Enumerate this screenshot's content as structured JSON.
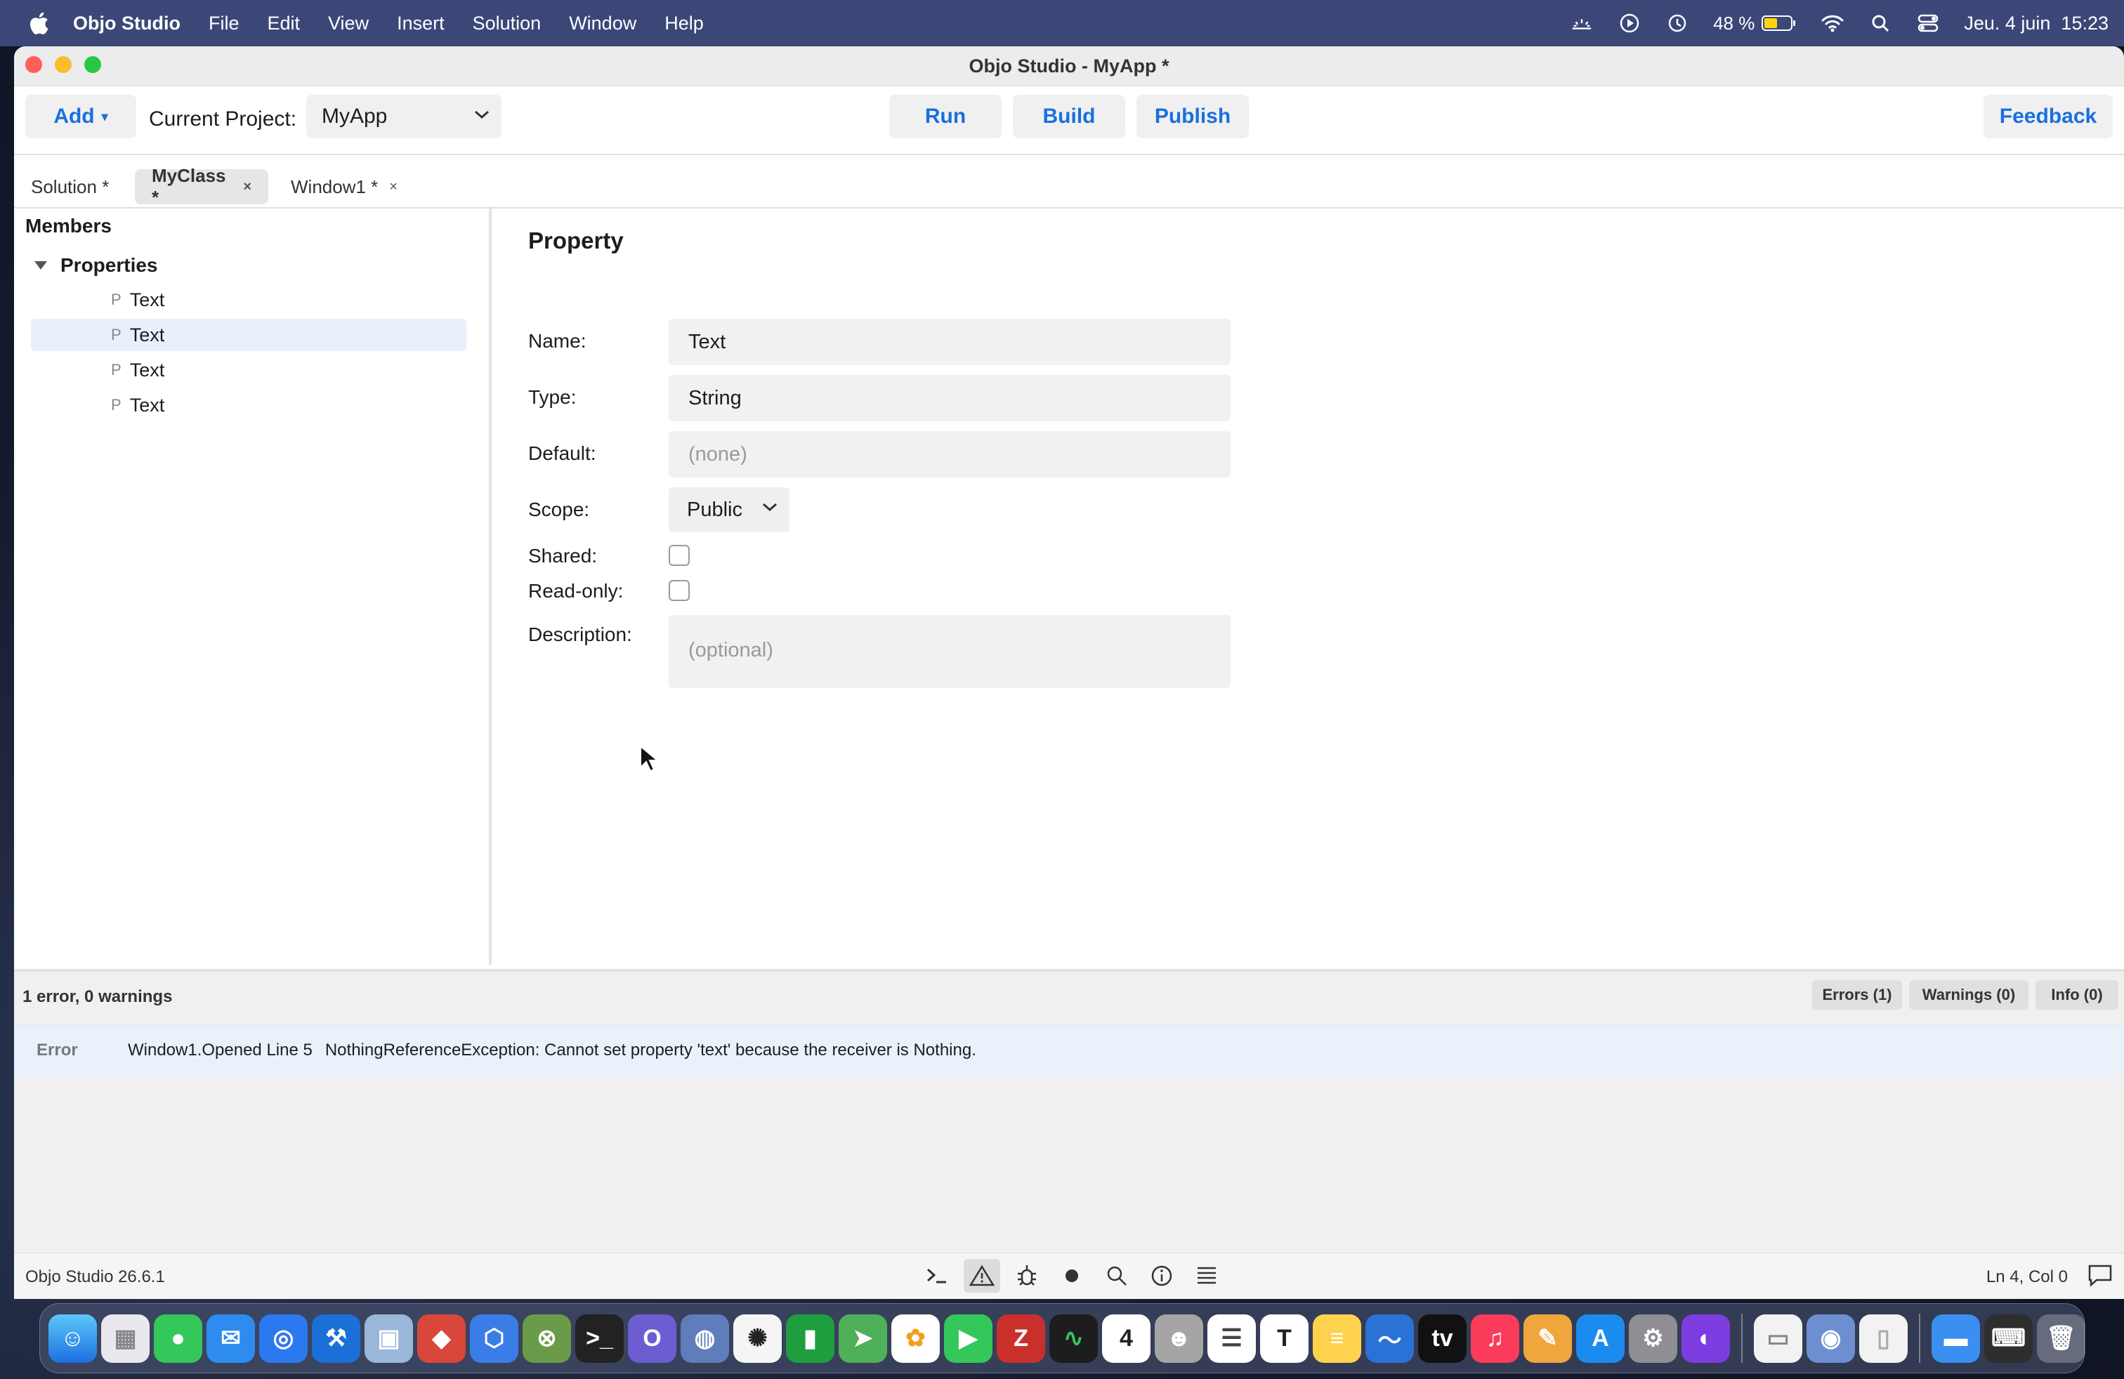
{
  "menubar": {
    "app_name": "Objo Studio",
    "menus": [
      "File",
      "Edit",
      "View",
      "Insert",
      "Solution",
      "Window",
      "Help"
    ],
    "battery": "48 %",
    "datetime": "Jeu. 4 juin  15:23"
  },
  "window": {
    "title": "Objo Studio - MyApp *"
  },
  "toolbar": {
    "add_label": "Add",
    "add_arrow": "▾",
    "project_label": "Current Project:",
    "project_value": "MyApp",
    "run_label": "Run",
    "build_label": "Build",
    "publish_label": "Publish",
    "feedback_label": "Feedback"
  },
  "tabs": [
    {
      "label": "Solution *",
      "close": ""
    },
    {
      "label": "MyClass *",
      "close": "×"
    },
    {
      "label": "Window1 *",
      "close": "×"
    }
  ],
  "members": {
    "title": "Members",
    "group_label": "Properties",
    "items": [
      {
        "tag": "P",
        "label": "Text"
      },
      {
        "tag": "P",
        "label": "Text"
      },
      {
        "tag": "P",
        "label": "Text"
      },
      {
        "tag": "P",
        "label": "Text"
      }
    ]
  },
  "property": {
    "heading": "Property",
    "name_label": "Name:",
    "name_value": "Text",
    "type_label": "Type:",
    "type_value": "String",
    "default_label": "Default:",
    "default_placeholder": "(none)",
    "scope_label": "Scope:",
    "scope_value": "Public",
    "shared_label": "Shared:",
    "readonly_label": "Read-only:",
    "description_label": "Description:",
    "description_placeholder": "(optional)"
  },
  "problems": {
    "summary": "1 error, 0 warnings",
    "filters": [
      "Errors (1)",
      "Warnings (0)",
      "Info (0)"
    ],
    "rows": [
      {
        "severity": "Error",
        "location": "Window1.Opened Line 5",
        "message": "NothingReferenceException: Cannot set property 'text' because the receiver is Nothing."
      }
    ]
  },
  "statusbar": {
    "version": "Objo Studio 26.6.1",
    "position": "Ln 4, Col 0"
  },
  "dock": {
    "calendar_day": "4",
    "icons": [
      "finder-icon",
      "launchpad-icon",
      "messages-icon",
      "mail-icon",
      "safari-icon",
      "xcode-icon",
      "preview-icon",
      "app-icon",
      "box-icon",
      "xbox-icon",
      "terminal-icon",
      "objo-icon",
      "globe-icon",
      "chatgpt-icon",
      "numbers-icon",
      "maps-icon",
      "photos-icon",
      "facetime-icon",
      "filezilla-icon",
      "activity-monitor-icon",
      "calendar-icon",
      "contacts-icon",
      "reminders-icon",
      "textedit-icon",
      "notes-icon",
      "freeform-icon",
      "apple-tv-icon",
      "music-icon",
      "pages-icon",
      "app-store-icon",
      "system-settings-icon",
      "firefox-icon",
      "window-icon",
      "disk-icon",
      "document-icon",
      "folder-icon",
      "keyboard-icon",
      "trash-icon"
    ]
  },
  "colors": {
    "accent": "#1a6fe0",
    "menubar": "#3c4778",
    "selection": "#e8f0fc"
  }
}
